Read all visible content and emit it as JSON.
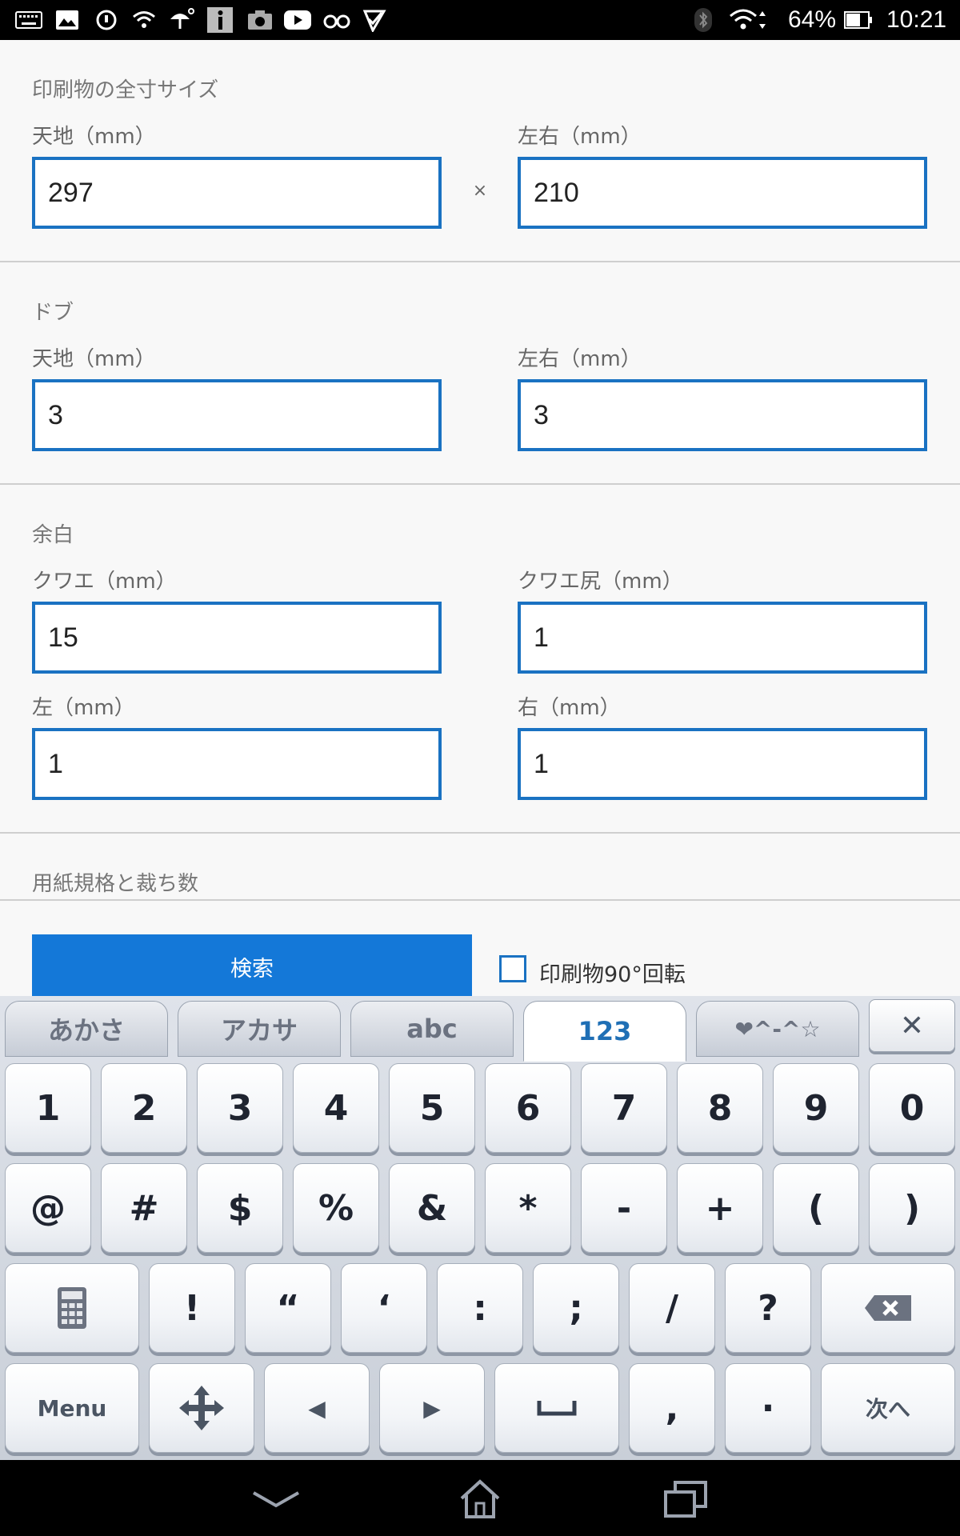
{
  "status_bar": {
    "battery_percent": "64%",
    "time": "10:21",
    "icons": [
      "keyboard-icon",
      "gallery-icon",
      "sync-icon",
      "wifi-icon",
      "umbrella-weather-icon",
      "info-icon",
      "camera-icon",
      "youtube-icon",
      "glasses-icon",
      "check-app-icon",
      "bluetooth-icon",
      "wifi-signal-icon",
      "battery-icon"
    ]
  },
  "sections": {
    "full_size": {
      "title": "印刷物の全寸サイズ",
      "height_label": "天地（mm）",
      "height_value": "297",
      "times": "×",
      "width_label": "左右（mm）",
      "width_value": "210"
    },
    "bleed": {
      "title": "ドブ",
      "height_label": "天地（mm）",
      "height_value": "3",
      "width_label": "左右（mm）",
      "width_value": "3"
    },
    "margin": {
      "title": "余白",
      "gripper_label": "クワエ（mm）",
      "gripper_value": "15",
      "tail_label": "クワエ尻（mm）",
      "tail_value": "1",
      "left_label": "左（mm）",
      "left_value": "1",
      "right_label": "右（mm）",
      "right_value": "1"
    },
    "paper": {
      "title": "用紙規格と裁ち数"
    }
  },
  "actions": {
    "search_label": "検索",
    "rotate_label": "印刷物90°回転",
    "rotate_checked": false
  },
  "keyboard": {
    "tabs": [
      "あかさ",
      "アカサ",
      "abc",
      "123",
      "❤^-^☆"
    ],
    "active_tab": "123",
    "close_label": "✕",
    "row1": [
      "1",
      "2",
      "3",
      "4",
      "5",
      "6",
      "7",
      "8",
      "9",
      "0"
    ],
    "row2": [
      "@",
      "#",
      "$",
      "%",
      "&",
      "*",
      "-",
      "+",
      "(",
      ")"
    ],
    "row3": [
      "!",
      "“",
      "‘",
      ":",
      ";",
      "/",
      "?"
    ],
    "menu_label": "Menu",
    "left_arrow": "◀",
    "right_arrow": "▶",
    "space_glyph": "␣",
    "comma": ",",
    "period": "·",
    "next_label": "次へ",
    "accent_color": "#1f6fb5"
  },
  "nav_bar": {
    "icons": [
      "back-icon",
      "home-icon",
      "recent-apps-icon"
    ]
  },
  "colors": {
    "input_border": "#1a72c2",
    "search_button": "#1478d8",
    "status_bar": "#000000"
  }
}
